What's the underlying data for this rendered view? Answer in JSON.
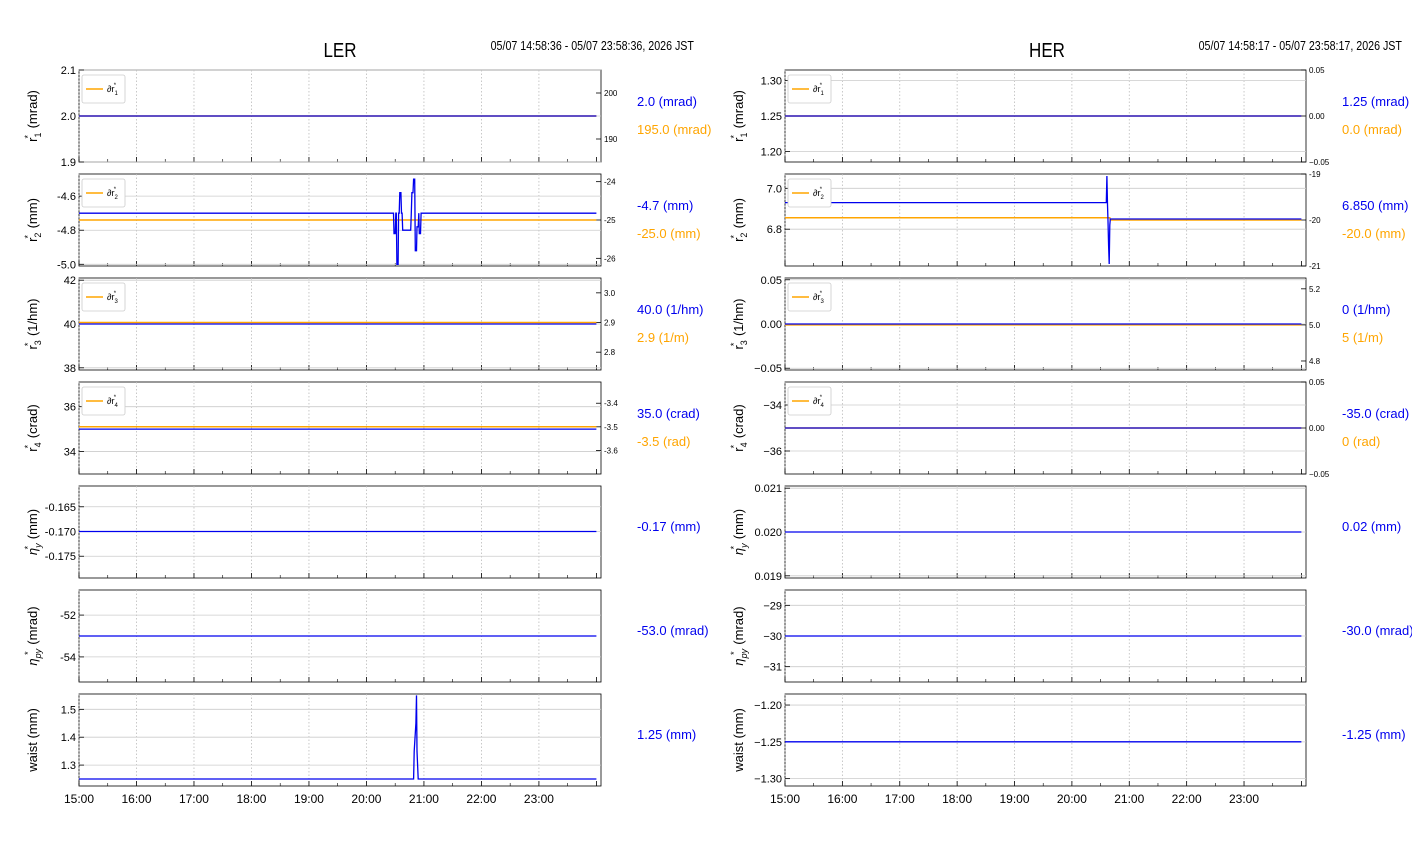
{
  "colors": {
    "primary": "#0000ee",
    "secondary": "#ffa500",
    "grid": "#bbbbbb"
  },
  "panels_x_ticks": [
    "15:00",
    "16:00",
    "17:00",
    "18:00",
    "19:00",
    "20:00",
    "21:00",
    "22:00",
    "23:00"
  ],
  "rings": [
    {
      "title": "LER",
      "time_range": "05/07 14:58:36 - 05/07 23:58:36, 2026 JST",
      "panels": [
        {
          "ylabel_main": "r",
          "ylabel_sub": "1",
          "ylabel_unit": "(mrad)",
          "yticks": [
            "2.1",
            "2.0",
            "1.9"
          ],
          "ylim": [
            1.9,
            2.1
          ],
          "ytick_values": [
            2.1,
            2.0,
            1.9
          ],
          "y2ticks": [
            "200",
            "190"
          ],
          "y2lim": [
            185,
            205
          ],
          "y2tick_values": [
            200,
            190
          ],
          "legend": "∂r",
          "legend_sub": "1",
          "primary_readout": "2.0 (mrad)",
          "secondary_readout": "195.0 (mrad)",
          "primary_series": [
            [
              15.0,
              2.0
            ],
            [
              24.0,
              2.0
            ]
          ],
          "secondary_series": [
            [
              15.0,
              195.0
            ],
            [
              24.0,
              195.0
            ]
          ]
        },
        {
          "ylabel_main": "r",
          "ylabel_sub": "2",
          "ylabel_unit": "(mm)",
          "yticks": [
            "-4.6",
            "-4.8",
            "-5.0"
          ],
          "ylim": [
            -5.01,
            -4.47
          ],
          "ytick_values": [
            -4.6,
            -4.8,
            -5.0
          ],
          "y2ticks": [
            "-24",
            "-25",
            "-26"
          ],
          "y2lim": [
            -26.2,
            -23.8
          ],
          "y2tick_values": [
            -24,
            -25,
            -26
          ],
          "legend": "∂r",
          "legend_sub": "2",
          "primary_readout": "-4.7 (mm)",
          "secondary_readout": "-25.0 (mm)",
          "primary_series": [
            [
              15.0,
              -4.7
            ],
            [
              20.47,
              -4.7
            ],
            [
              20.48,
              -4.82
            ],
            [
              20.5,
              -4.82
            ],
            [
              20.51,
              -4.7
            ],
            [
              20.52,
              -4.7
            ],
            [
              20.53,
              -5.0
            ],
            [
              20.55,
              -5.0
            ],
            [
              20.56,
              -4.7
            ],
            [
              20.57,
              -4.7
            ],
            [
              20.58,
              -4.58
            ],
            [
              20.6,
              -4.58
            ],
            [
              20.61,
              -4.7
            ],
            [
              20.62,
              -4.7
            ],
            [
              20.63,
              -4.8
            ],
            [
              20.77,
              -4.8
            ],
            [
              20.78,
              -4.7
            ],
            [
              20.79,
              -4.58
            ],
            [
              20.81,
              -4.58
            ],
            [
              20.82,
              -4.5
            ],
            [
              20.84,
              -4.5
            ],
            [
              20.85,
              -4.92
            ],
            [
              20.87,
              -4.92
            ],
            [
              20.88,
              -4.78
            ],
            [
              20.9,
              -4.78
            ],
            [
              20.91,
              -4.7
            ],
            [
              20.92,
              -4.82
            ],
            [
              20.94,
              -4.82
            ],
            [
              20.95,
              -4.7
            ],
            [
              24.0,
              -4.7
            ]
          ],
          "secondary_series": [
            [
              15.0,
              -25.0
            ],
            [
              24.0,
              -25.0
            ]
          ]
        },
        {
          "ylabel_main": "r",
          "ylabel_sub": "3",
          "ylabel_unit": "(1/hm)",
          "yticks": [
            "42",
            "40",
            "38"
          ],
          "ylim": [
            37.9,
            42.1
          ],
          "ytick_values": [
            42,
            40,
            38
          ],
          "y2ticks": [
            "3.0",
            "2.9",
            "2.8"
          ],
          "y2lim": [
            2.74,
            3.05
          ],
          "y2tick_values": [
            3.0,
            2.9,
            2.8
          ],
          "legend": "∂r",
          "legend_sub": "3",
          "primary_readout": "40.0 (1/hm)",
          "secondary_readout": "2.9 (1/m)",
          "primary_series": [
            [
              15.0,
              40.0
            ],
            [
              24.0,
              40.0
            ]
          ],
          "secondary_series": [
            [
              15.0,
              2.9
            ],
            [
              24.0,
              2.9
            ]
          ]
        },
        {
          "ylabel_main": "r",
          "ylabel_sub": "4",
          "ylabel_unit": "(crad)",
          "yticks": [
            "36",
            "34"
          ],
          "ylim": [
            33.0,
            37.1
          ],
          "ytick_values": [
            36,
            34
          ],
          "y2ticks": [
            "-3.4",
            "-3.5",
            "-3.6"
          ],
          "y2lim": [
            -3.7,
            -3.31
          ],
          "y2tick_values": [
            -3.4,
            -3.5,
            -3.6
          ],
          "legend": "∂r",
          "legend_sub": "4",
          "primary_readout": "35.0 (crad)",
          "secondary_readout": "-3.5 (rad)",
          "primary_series": [
            [
              15.0,
              35.0
            ],
            [
              24.0,
              35.0
            ]
          ],
          "secondary_series": [
            [
              15.0,
              -3.5
            ],
            [
              24.0,
              -3.5
            ]
          ]
        },
        {
          "ylabel_main": "η",
          "ylabel_sub": "y",
          "ylabel_unit": "(mm)",
          "yticks": [
            "-0.165",
            "-0.170",
            "-0.175"
          ],
          "ylim": [
            -0.1794,
            -0.1608
          ],
          "ytick_values": [
            -0.165,
            -0.17,
            -0.175
          ],
          "primary_readout": "-0.17 (mm)",
          "primary_series": [
            [
              15.0,
              -0.17
            ],
            [
              24.0,
              -0.17
            ]
          ]
        },
        {
          "ylabel_main": "η",
          "ylabel_sub": "py",
          "ylabel_unit": "(mrad)",
          "yticks": [
            "-52",
            "-54"
          ],
          "ylim": [
            -55.2,
            -50.8
          ],
          "ytick_values": [
            -52,
            -54
          ],
          "primary_readout": "-53.0 (mrad)",
          "primary_series": [
            [
              15.0,
              -53.0
            ],
            [
              24.0,
              -53.0
            ]
          ]
        },
        {
          "ylabel_main": "waist",
          "ylabel_sub": "",
          "ylabel_unit": "(mm)",
          "yticks": [
            "1.5",
            "1.4",
            "1.3"
          ],
          "ylim": [
            1.225,
            1.555
          ],
          "ytick_values": [
            1.5,
            1.4,
            1.3
          ],
          "primary_readout": "1.25 (mm)",
          "primary_series": [
            [
              15.0,
              1.25
            ],
            [
              20.82,
              1.25
            ],
            [
              20.83,
              1.35
            ],
            [
              20.86,
              1.45
            ],
            [
              20.87,
              1.55
            ],
            [
              20.88,
              1.35
            ],
            [
              20.9,
              1.25
            ],
            [
              24.0,
              1.25
            ]
          ]
        }
      ]
    },
    {
      "title": "HER",
      "time_range": "05/07 14:58:17 - 05/07 23:58:17, 2026 JST",
      "panels": [
        {
          "ylabel_main": "r",
          "ylabel_sub": "1",
          "ylabel_unit": "(mrad)",
          "yticks": [
            "1.30",
            "1.25",
            "1.20"
          ],
          "ylim": [
            1.185,
            1.315
          ],
          "ytick_values": [
            1.3,
            1.25,
            1.2
          ],
          "y2ticks": [
            "0.05",
            "0.00",
            "−0.05"
          ],
          "y2lim": [
            -0.05,
            0.05
          ],
          "y2tick_values": [
            0.05,
            0.0,
            -0.05
          ],
          "legend": "∂r",
          "legend_sub": "1",
          "primary_readout": "1.25 (mrad)",
          "secondary_readout": "0.0 (mrad)",
          "primary_series": [
            [
              15.0,
              1.25
            ],
            [
              24.0,
              1.25
            ]
          ],
          "secondary_series": [
            [
              15.0,
              0.0
            ],
            [
              24.0,
              0.0
            ]
          ]
        },
        {
          "ylabel_main": "r",
          "ylabel_sub": "2",
          "ylabel_unit": "(mm)",
          "yticks": [
            "7.0",
            "6.8"
          ],
          "ylim": [
            6.62,
            7.07
          ],
          "ytick_values": [
            7.0,
            6.8
          ],
          "y2ticks": [
            "-19",
            "-20",
            "-21"
          ],
          "y2lim": [
            -21.0,
            -19.0
          ],
          "y2tick_values": [
            -19,
            -20,
            -21
          ],
          "legend": "∂r",
          "legend_sub": "2",
          "primary_readout": "6.850 (mm)",
          "secondary_readout": "-20.0 (mm)",
          "primary_series": [
            [
              15.0,
              6.93
            ],
            [
              20.6,
              6.93
            ],
            [
              20.61,
              7.06
            ],
            [
              20.62,
              6.92
            ],
            [
              20.63,
              6.84
            ],
            [
              20.64,
              6.72
            ],
            [
              20.65,
              6.63
            ],
            [
              20.66,
              6.82
            ],
            [
              20.67,
              6.85
            ],
            [
              24.0,
              6.85
            ]
          ],
          "secondary_series": [
            [
              15.0,
              -19.95
            ],
            [
              20.66,
              -19.95
            ],
            [
              20.67,
              -20.0
            ],
            [
              24.0,
              -20.0
            ]
          ]
        },
        {
          "ylabel_main": "r",
          "ylabel_sub": "3",
          "ylabel_unit": "(1/hm)",
          "yticks": [
            "0.05",
            "0.00",
            "−0.05"
          ],
          "ylim": [
            -0.052,
            0.052
          ],
          "ytick_values": [
            0.05,
            0.0,
            -0.05
          ],
          "y2ticks": [
            "5.2",
            "5.0",
            "4.8"
          ],
          "y2lim": [
            4.75,
            5.26
          ],
          "y2tick_values": [
            5.2,
            5.0,
            4.8
          ],
          "legend": "∂r",
          "legend_sub": "3",
          "primary_readout": "0 (1/hm)",
          "secondary_readout": "5 (1/m)",
          "primary_series": [
            [
              15.0,
              0.0
            ],
            [
              24.0,
              0.0
            ]
          ],
          "secondary_series": [
            [
              15.0,
              5.0
            ],
            [
              24.0,
              5.0
            ]
          ]
        },
        {
          "ylabel_main": "r",
          "ylabel_sub": "4",
          "ylabel_unit": "(crad)",
          "yticks": [
            "−34",
            "−36"
          ],
          "ylim": [
            -37.0,
            -33.0
          ],
          "ytick_values": [
            -34,
            -36
          ],
          "y2ticks": [
            "0.05",
            "0.00",
            "−0.05"
          ],
          "y2lim": [
            -0.05,
            0.05
          ],
          "y2tick_values": [
            0.05,
            0.0,
            -0.05
          ],
          "legend": "∂r",
          "legend_sub": "4",
          "primary_readout": "-35.0 (crad)",
          "secondary_readout": "0 (rad)",
          "primary_series": [
            [
              15.0,
              -35.0
            ],
            [
              24.0,
              -35.0
            ]
          ],
          "secondary_series": [
            [
              15.0,
              0.0
            ],
            [
              24.0,
              0.0
            ]
          ]
        },
        {
          "ylabel_main": "η",
          "ylabel_sub": "y",
          "ylabel_unit": "(mm)",
          "yticks": [
            "0.021",
            "0.020",
            "0.019"
          ],
          "ylim": [
            0.01895,
            0.02105
          ],
          "ytick_values": [
            0.021,
            0.02,
            0.019
          ],
          "primary_readout": "0.02 (mm)",
          "primary_series": [
            [
              15.0,
              0.02
            ],
            [
              24.0,
              0.02
            ]
          ]
        },
        {
          "ylabel_main": "η",
          "ylabel_sub": "py",
          "ylabel_unit": "(mrad)",
          "yticks": [
            "−29",
            "−30",
            "−31"
          ],
          "ylim": [
            -31.5,
            -28.5
          ],
          "ytick_values": [
            -29,
            -30,
            -31
          ],
          "primary_readout": "-30.0 (mrad)",
          "primary_series": [
            [
              15.0,
              -30.0
            ],
            [
              24.0,
              -30.0
            ]
          ]
        },
        {
          "ylabel_main": "waist",
          "ylabel_sub": "",
          "ylabel_unit": "(mm)",
          "yticks": [
            "−1.20",
            "−1.25",
            "−1.30"
          ],
          "ylim": [
            -1.31,
            -1.185
          ],
          "ytick_values": [
            -1.2,
            -1.25,
            -1.3
          ],
          "primary_readout": "-1.25 (mm)",
          "primary_series": [
            [
              15.0,
              -1.25
            ],
            [
              24.0,
              -1.25
            ]
          ]
        }
      ]
    }
  ],
  "chart_data": [
    {
      "type": "line",
      "title": "LER",
      "subtitle": "05/07 14:58:36 - 05/07 23:58:36, 2026 JST",
      "x_ticks": [
        "15:00",
        "16:00",
        "17:00",
        "18:00",
        "19:00",
        "20:00",
        "21:00",
        "22:00",
        "23:00"
      ],
      "series": [
        {
          "ylabel": "r1* (mrad)",
          "value": 2.0,
          "secondary_value": 195.0,
          "legend": "∂r1*"
        },
        {
          "ylabel": "r2* (mm)",
          "value": -4.7,
          "secondary_value": -25.0,
          "legend": "∂r2*"
        },
        {
          "ylabel": "r3* (1/hm)",
          "value": 40.0,
          "secondary_value": 2.9,
          "legend": "∂r3*"
        },
        {
          "ylabel": "r4* (crad)",
          "value": 35.0,
          "secondary_value": -3.5,
          "legend": "∂r4*"
        },
        {
          "ylabel": "ηy* (mm)",
          "value": -0.17
        },
        {
          "ylabel": "ηpy* (mrad)",
          "value": -53.0
        },
        {
          "ylabel": "waist (mm)",
          "value": 1.25
        }
      ]
    },
    {
      "type": "line",
      "title": "HER",
      "subtitle": "05/07 14:58:17 - 05/07 23:58:17, 2026 JST",
      "x_ticks": [
        "15:00",
        "16:00",
        "17:00",
        "18:00",
        "19:00",
        "20:00",
        "21:00",
        "22:00",
        "23:00"
      ],
      "series": [
        {
          "ylabel": "r1* (mrad)",
          "value": 1.25,
          "secondary_value": 0.0,
          "legend": "∂r1*"
        },
        {
          "ylabel": "r2* (mm)",
          "value": 6.85,
          "secondary_value": -20.0,
          "legend": "∂r2*"
        },
        {
          "ylabel": "r3* (1/hm)",
          "value": 0.0,
          "secondary_value": 5.0,
          "legend": "∂r3*"
        },
        {
          "ylabel": "r4* (crad)",
          "value": -35.0,
          "secondary_value": 0.0,
          "legend": "∂r4*"
        },
        {
          "ylabel": "ηy* (mm)",
          "value": 0.02
        },
        {
          "ylabel": "ηpy* (mrad)",
          "value": -30.0
        },
        {
          "ylabel": "waist (mm)",
          "value": -1.25
        }
      ]
    }
  ]
}
